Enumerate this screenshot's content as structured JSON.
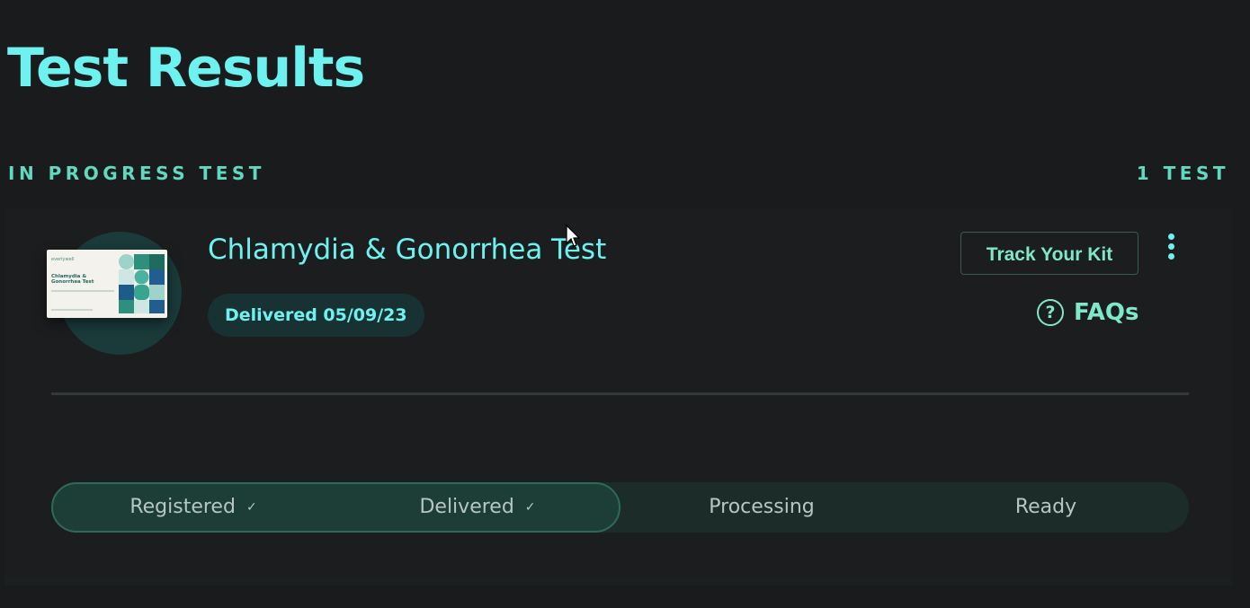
{
  "page": {
    "title": "Test Results"
  },
  "section": {
    "label": "IN PROGRESS TEST",
    "count": "1 TEST"
  },
  "test_card": {
    "kit_image": {
      "brand": "everlywell",
      "name": "Chlamydia & Gonorrhea Test"
    },
    "name": "Chlamydia & Gonorrhea Test",
    "status": "Delivered 05/09/23",
    "track_button": "Track Your Kit",
    "more_icon": "vertical-ellipsis-icon",
    "faqs": {
      "icon": "question-circle-icon",
      "icon_glyph": "?",
      "label": "FAQs"
    },
    "progress": {
      "steps": [
        {
          "label": "Registered",
          "complete": true,
          "check": "✓"
        },
        {
          "label": "Delivered",
          "complete": true,
          "check": "✓"
        },
        {
          "label": "Processing",
          "complete": false
        },
        {
          "label": "Ready",
          "complete": false
        }
      ],
      "completed_fraction": 0.5
    }
  },
  "colors": {
    "background": "#191b1d",
    "accent_cyan": "#6ef2ef",
    "accent_green": "#7fe8c8",
    "section_label": "#62d8be",
    "pill_bg": "#183133",
    "progress_track": "#1c2c28",
    "progress_fill": "#1d3e37"
  }
}
